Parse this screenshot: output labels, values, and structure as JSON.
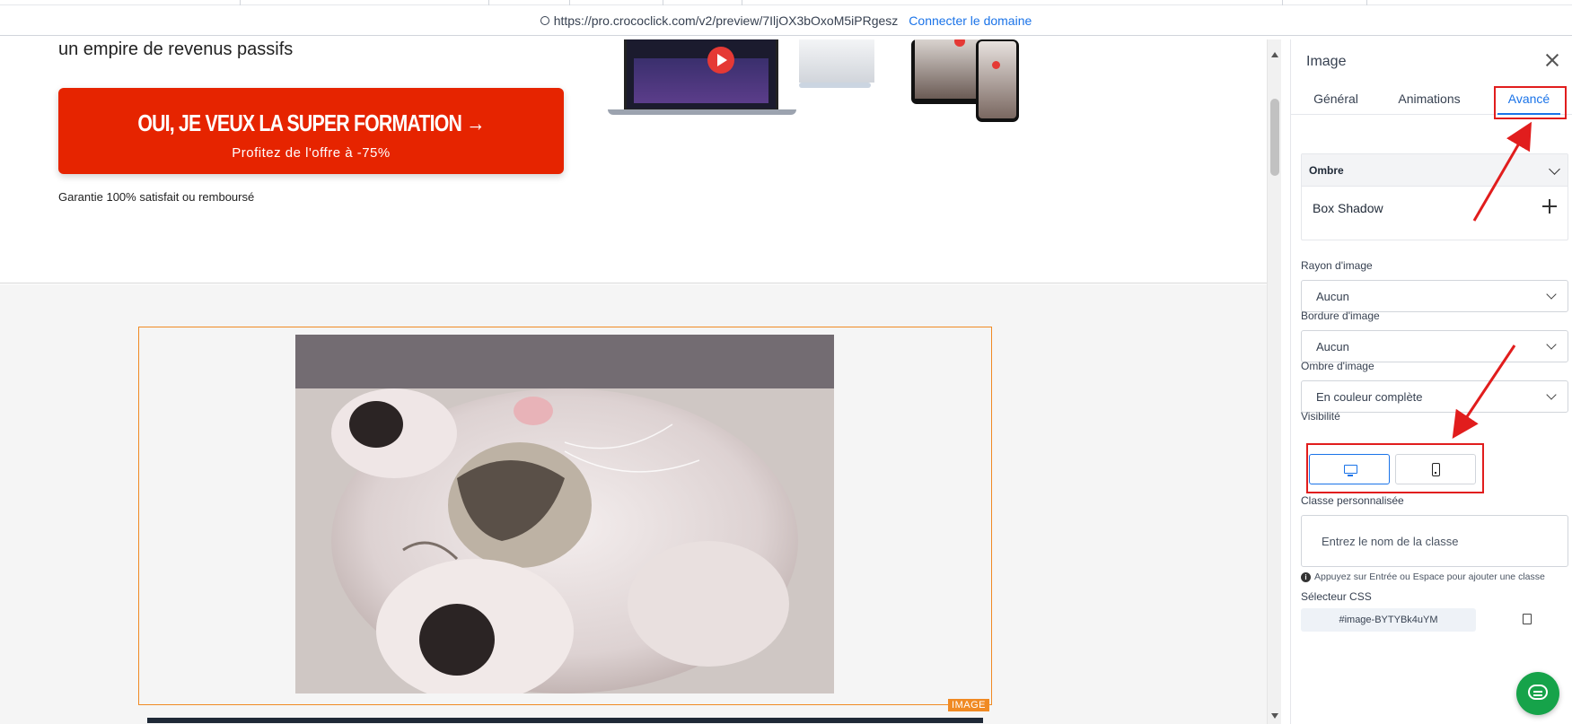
{
  "browser": {
    "url": "https://pro.crococlick.com/v2/preview/7IljOX3bOxoM5iPRgesz",
    "connect_link": "Connecter le domaine"
  },
  "page": {
    "headline": "un empire de revenus passifs",
    "cta_main": "OUI, JE VEUX LA SUPER FORMATION →",
    "cta_sub": "Profitez de l'offre à -75%",
    "guarantee": "Garantie 100% satisfait ou remboursé",
    "image_badge": "IMAGE"
  },
  "panel": {
    "title": "Image",
    "tabs": [
      {
        "label": "Général",
        "active": false
      },
      {
        "label": "Animations",
        "active": false
      },
      {
        "label": "Avancé",
        "active": true
      }
    ],
    "shadow_section": {
      "header": "Ombre",
      "row_label": "Box Shadow"
    },
    "image_radius": {
      "label": "Rayon d'image",
      "value": "Aucun"
    },
    "image_border": {
      "label": "Bordure d'image",
      "value": "Aucun"
    },
    "image_shadow": {
      "label": "Ombre d'image",
      "value": "En couleur complète"
    },
    "visibility": {
      "label": "Visibilité",
      "desktop_active": true,
      "mobile_active": false
    },
    "custom_class": {
      "label": "Classe personnalisée",
      "placeholder": "Entrez le nom de la classe",
      "hint": "Appuyez sur Entrée ou Espace pour ajouter une classe"
    },
    "css_selector": {
      "label": "Sélecteur CSS",
      "value": "#image-BYTYBk4uYM"
    }
  },
  "colors": {
    "accent": "#1a73e8",
    "cta": "#e62400",
    "annotation": "#e11d1d",
    "selection": "#f08a24",
    "chat": "#16a34a"
  },
  "icons": [
    "circle-icon",
    "play-icon",
    "close-icon",
    "chevron-down-icon",
    "plus-icon",
    "desktop-icon",
    "mobile-icon",
    "info-icon",
    "copy-icon",
    "chat-icon",
    "arrow-right-icon"
  ]
}
